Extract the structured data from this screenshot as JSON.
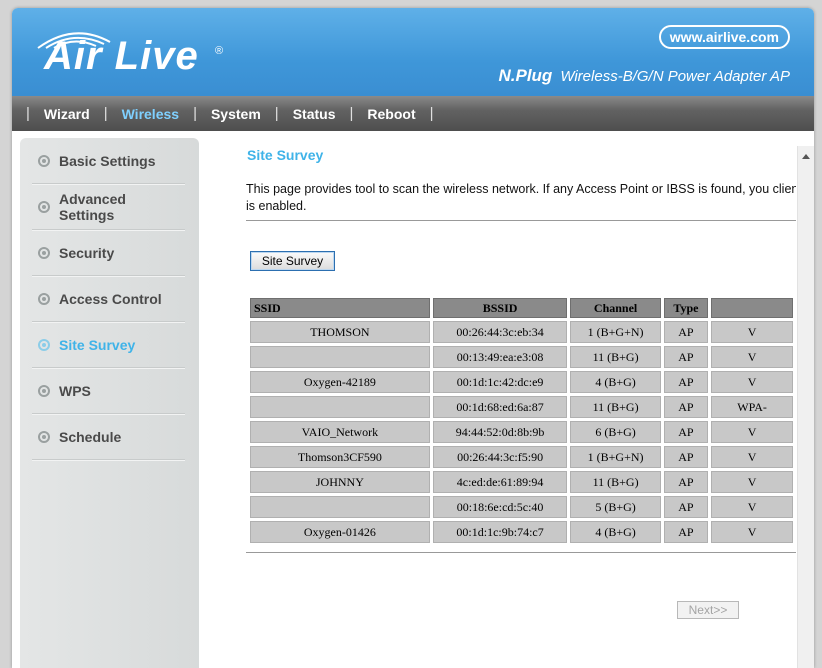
{
  "header": {
    "logo_text": "Air Live",
    "logo_reg": "®",
    "site_url": "www.airlive.com",
    "product_name": "N.Plug",
    "product_desc": "Wireless-B/G/N Power Adapter AP"
  },
  "menu": {
    "items": [
      {
        "label": "Wizard"
      },
      {
        "label": "Wireless"
      },
      {
        "label": "System"
      },
      {
        "label": "Status"
      },
      {
        "label": "Reboot"
      }
    ],
    "active": "Wireless"
  },
  "sidebar": {
    "items": [
      {
        "label": "Basic Settings"
      },
      {
        "label": "Advanced Settings"
      },
      {
        "label": "Security"
      },
      {
        "label": "Access Control"
      },
      {
        "label": "Site Survey"
      },
      {
        "label": "WPS"
      },
      {
        "label": "Schedule"
      }
    ],
    "active": "Site Survey"
  },
  "main": {
    "title": "Site Survey",
    "description": "This page provides tool to scan the wireless network. If any Access Point or IBSS is found, you client mode is enabled.",
    "survey_button": "Site Survey",
    "next_button": "Next>>",
    "table": {
      "headers": [
        "SSID",
        "BSSID",
        "Channel",
        "Type",
        ""
      ],
      "rows": [
        [
          "THOMSON",
          "00:26:44:3c:eb:34",
          "1 (B+G+N)",
          "AP",
          "V"
        ],
        [
          "",
          "00:13:49:ea:e3:08",
          "11 (B+G)",
          "AP",
          "V"
        ],
        [
          "Oxygen-42189",
          "00:1d:1c:42:dc:e9",
          "4 (B+G)",
          "AP",
          "V"
        ],
        [
          "",
          "00:1d:68:ed:6a:87",
          "11 (B+G)",
          "AP",
          "WPA-"
        ],
        [
          "VAIO_Network",
          "94:44:52:0d:8b:9b",
          "6 (B+G)",
          "AP",
          "V"
        ],
        [
          "Thomson3CF590",
          "00:26:44:3c:f5:90",
          "1 (B+G+N)",
          "AP",
          "V"
        ],
        [
          "JOHNNY",
          "4c:ed:de:61:89:94",
          "11 (B+G)",
          "AP",
          "V"
        ],
        [
          "",
          "00:18:6e:cd:5c:40",
          "5 (B+G)",
          "AP",
          "V"
        ],
        [
          "Oxygen-01426",
          "00:1d:1c:9b:74:c7",
          "4 (B+G)",
          "AP",
          "V"
        ]
      ]
    }
  },
  "colors": {
    "header_blue": "#3f97d9",
    "accent_cyan": "#3fb3e8",
    "menu_gray": "#5a5a5a"
  }
}
